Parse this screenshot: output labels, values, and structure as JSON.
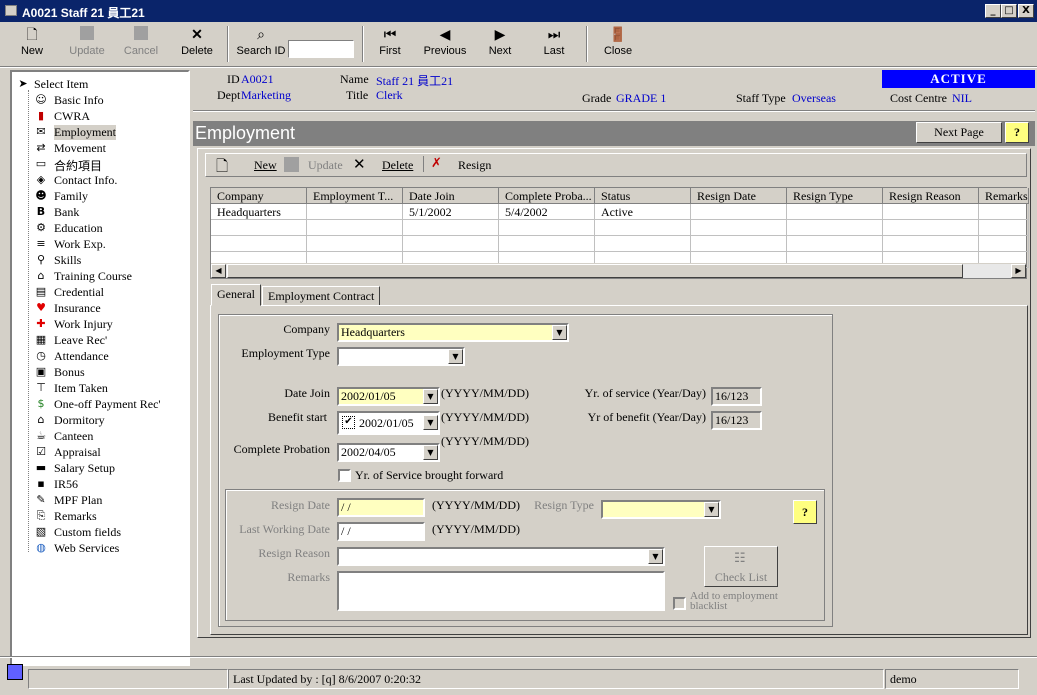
{
  "window": {
    "title": "A0021 Staff 21 員工21",
    "buttons": {
      "min": "_",
      "max": "□",
      "close": "X"
    }
  },
  "toolbar": {
    "new": "New",
    "update": "Update",
    "cancel": "Cancel",
    "delete": "Delete",
    "search_id": "Search ID",
    "search_value": "",
    "first": "First",
    "previous": "Previous",
    "next": "Next",
    "last": "Last",
    "close": "Close"
  },
  "sidebar": {
    "items": [
      {
        "label": "Select Item",
        "icon": "cursor-icon"
      },
      {
        "label": "Basic Info",
        "icon": "person-icon"
      },
      {
        "label": "CWRA",
        "icon": "book-icon"
      },
      {
        "label": "Employment",
        "icon": "envelope-icon"
      },
      {
        "label": "Movement",
        "icon": "movement-icon"
      },
      {
        "label": "合約項目",
        "icon": "folder-icon"
      },
      {
        "label": "Contact Info.",
        "icon": "contact-icon"
      },
      {
        "label": "Family",
        "icon": "family-icon"
      },
      {
        "label": "Bank",
        "icon": "bank-icon"
      },
      {
        "label": "Education",
        "icon": "education-icon"
      },
      {
        "label": "Work Exp.",
        "icon": "document-icon"
      },
      {
        "label": "Skills",
        "icon": "skills-icon"
      },
      {
        "label": "Training Course",
        "icon": "training-icon"
      },
      {
        "label": "Credential",
        "icon": "credential-icon"
      },
      {
        "label": "Insurance",
        "icon": "heart-icon"
      },
      {
        "label": "Work Injury",
        "icon": "injury-icon"
      },
      {
        "label": "Leave Rec'",
        "icon": "calendar-icon"
      },
      {
        "label": "Attendance",
        "icon": "clock-icon"
      },
      {
        "label": "Bonus",
        "icon": "bonus-icon"
      },
      {
        "label": "Item Taken",
        "icon": "item-icon"
      },
      {
        "label": "One-off Payment Rec'",
        "icon": "payment-icon"
      },
      {
        "label": "Dormitory",
        "icon": "house-icon"
      },
      {
        "label": "Canteen",
        "icon": "canteen-icon"
      },
      {
        "label": "Appraisal",
        "icon": "checkbox-icon"
      },
      {
        "label": "Salary Setup",
        "icon": "salary-icon"
      },
      {
        "label": "IR56",
        "icon": "disk-icon"
      },
      {
        "label": "MPF Plan",
        "icon": "mpf-icon"
      },
      {
        "label": "Remarks",
        "icon": "paperclip-icon"
      },
      {
        "label": "Custom fields",
        "icon": "custom-icon"
      },
      {
        "label": "Web Services",
        "icon": "globe-icon"
      }
    ],
    "selected": "Employment"
  },
  "header": {
    "id_label": "ID",
    "id_value": "A0021",
    "name_label": "Name",
    "name_value": "Staff 21 員工21",
    "dept_label": "Dept",
    "dept_value": "Marketing",
    "title_label": "Title",
    "title_value": "Clerk",
    "grade_label": "Grade",
    "grade_value": "GRADE 1",
    "stafftype_label": "Staff Type",
    "stafftype_value": "Overseas",
    "costcentre_label": "Cost Centre",
    "costcentre_value": "NIL",
    "status": "ACTIVE"
  },
  "section": {
    "title": "Employment",
    "next_page": "Next Page",
    "help": "?"
  },
  "subtoolbar": {
    "new": "New",
    "update": "Update",
    "delete": "Delete",
    "resign": "Resign"
  },
  "grid": {
    "columns": [
      "Company",
      "Employment T...",
      "Date Join",
      "Complete Proba...",
      "Status",
      "Resign Date",
      "Resign Type",
      "Resign Reason",
      "Remarks"
    ],
    "rows": [
      [
        "Headquarters",
        "",
        "5/1/2002",
        "5/4/2002",
        "Active",
        "",
        "",
        "",
        ""
      ]
    ]
  },
  "tabs": [
    "General",
    "Employment Contract"
  ],
  "form": {
    "company_label": "Company",
    "company_value": "Headquarters",
    "emptype_label": "Employment Type",
    "emptype_value": "",
    "datejoin_label": "Date Join",
    "datejoin_value": "2002/01/05",
    "benefit_label": "Benefit start",
    "benefit_value": "2002/01/05",
    "probation_label": "Complete Probation",
    "probation_value": "2002/04/05",
    "date_format": "(YYYY/MM/DD)",
    "yrservice_label": "Yr. of service (Year/Day)",
    "yrservice_value": "16/123",
    "yrbenefit_label": "Yr of benefit (Year/Day)",
    "yrbenefit_value": "16/123",
    "brought_forward": "Yr. of Service brought forward",
    "resigndate_label": "Resign Date",
    "resigndate_value": " / /",
    "lastwork_label": "Last Working Date",
    "lastwork_value": " / /",
    "resigntype_label": "Resign Type",
    "resigntype_value": "",
    "resignreason_label": "Resign Reason",
    "resignreason_value": "",
    "remarks_label": "Remarks",
    "remarks_value": "",
    "checklist": "Check List",
    "blacklist": "Add to employment blacklist",
    "help": "?"
  },
  "status": {
    "last_updated": "Last Updated by : [q]  8/6/2007 0:20:32",
    "user": "demo"
  }
}
